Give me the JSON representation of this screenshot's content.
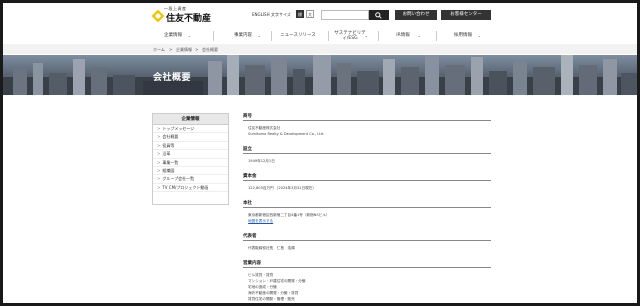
{
  "header": {
    "logo_tagline": "一段上資産",
    "logo_brand": "住友不動産",
    "lang": "ENGLISH",
    "fontsize_label": "文字サイズ",
    "fontsize_options": [
      "標準",
      "大"
    ],
    "search_placeholder": "",
    "contact_button": "お問い合わせ",
    "customer_center_button": "お客様センター"
  },
  "nav": {
    "items": [
      {
        "label": "企業情報"
      },
      {
        "label": "事業内容"
      },
      {
        "label": "ニュースリリース"
      },
      {
        "label": "サステナビリティ/ESG"
      },
      {
        "label": "IR情報"
      },
      {
        "label": "採用情報"
      }
    ]
  },
  "breadcrumb": [
    "ホーム",
    "企業情報",
    "会社概要"
  ],
  "hero": {
    "title": "会社概要"
  },
  "sidebar": {
    "title": "企業情報",
    "items": [
      "トップメッセージ",
      "会社概要",
      "役員等",
      "沿革",
      "事業一覧",
      "組織図",
      "グループ会社一覧",
      "TV CM/プロジェクト動画"
    ]
  },
  "content": {
    "sections": [
      {
        "heading": "商号",
        "lines": [
          "住友不動産株式会社",
          "Sumitomo Realty & Development Co., Ltd."
        ]
      },
      {
        "heading": "設立",
        "lines": [
          "1949年12月1日"
        ]
      },
      {
        "heading": "資本金",
        "lines": [
          "122,805百万円 （2024年3月31日現在）"
        ]
      },
      {
        "heading": "本社",
        "lines": [
          "東京都新宿区西新宿二丁目4番1号（新宿NSビル）"
        ],
        "link": "地図を表示する"
      },
      {
        "heading": "代表者",
        "lines": [
          "代表取締役社長　仁島　浩順"
        ]
      },
      {
        "heading": "営業内容",
        "lines": [
          "ビル賃貸・賃貸",
          "マンション・戸建住宅の開発・分譲",
          "宅地の造成・分譲",
          "海外不動産の開発・分譲・賃貸",
          "賃貸住宅の開発・管理・販売"
        ]
      }
    ]
  }
}
